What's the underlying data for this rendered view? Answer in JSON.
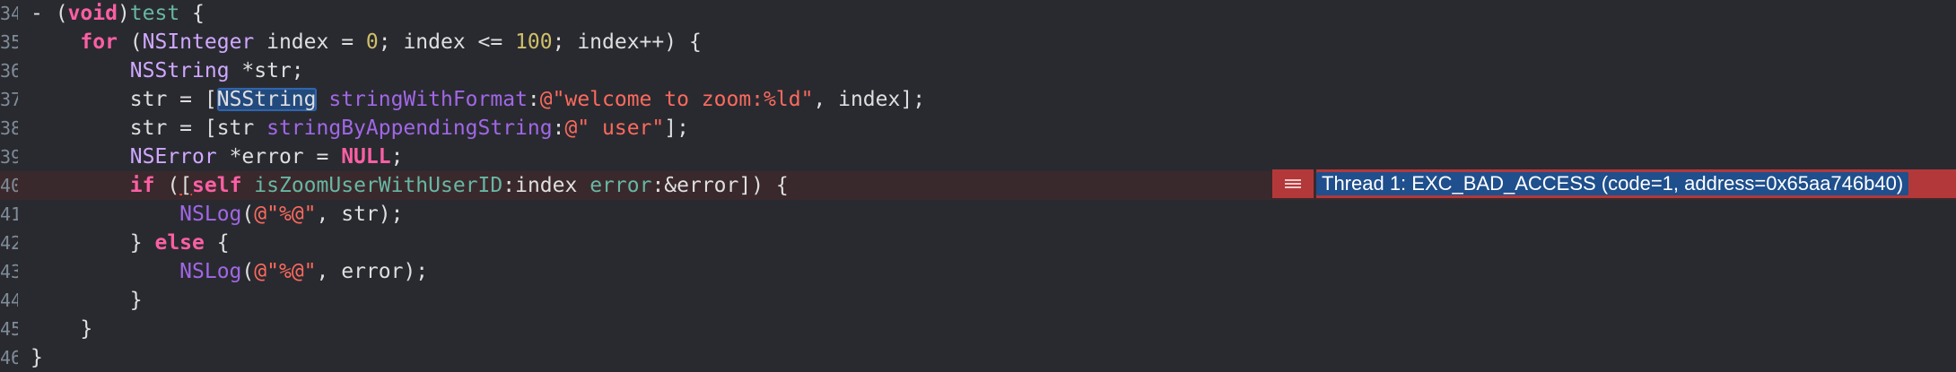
{
  "editor": {
    "lines": [
      {
        "number": "34",
        "tokens": [
          {
            "t": "- (",
            "c": "plain"
          },
          {
            "t": "void",
            "c": "kw"
          },
          {
            "t": ")",
            "c": "plain"
          },
          {
            "t": "test",
            "c": "fnb"
          },
          {
            "t": " {",
            "c": "plain"
          }
        ]
      },
      {
        "number": "35",
        "tokens": [
          {
            "t": "    ",
            "c": "plain"
          },
          {
            "t": "for",
            "c": "kw"
          },
          {
            "t": " (",
            "c": "plain"
          },
          {
            "t": "NSInteger",
            "c": "type"
          },
          {
            "t": " index = ",
            "c": "plain"
          },
          {
            "t": "0",
            "c": "num"
          },
          {
            "t": "; index <= ",
            "c": "plain"
          },
          {
            "t": "100",
            "c": "num"
          },
          {
            "t": "; index++) {",
            "c": "plain"
          }
        ]
      },
      {
        "number": "36",
        "tokens": [
          {
            "t": "        ",
            "c": "plain"
          },
          {
            "t": "NSString",
            "c": "type"
          },
          {
            "t": " *str;",
            "c": "plain"
          }
        ]
      },
      {
        "number": "37",
        "tokens": [
          {
            "t": "        str = [",
            "c": "plain"
          },
          {
            "t": "NSString",
            "c": "sel"
          },
          {
            "t": " ",
            "c": "plain"
          },
          {
            "t": "stringWithFormat",
            "c": "fn"
          },
          {
            "t": ":",
            "c": "plain"
          },
          {
            "t": "@\"welcome to zoom:%ld\"",
            "c": "str"
          },
          {
            "t": ", index];",
            "c": "plain"
          }
        ]
      },
      {
        "number": "38",
        "tokens": [
          {
            "t": "        str = [str ",
            "c": "plain"
          },
          {
            "t": "stringByAppendingString",
            "c": "fn"
          },
          {
            "t": ":",
            "c": "plain"
          },
          {
            "t": "@\" user\"",
            "c": "str"
          },
          {
            "t": "];",
            "c": "plain"
          }
        ]
      },
      {
        "number": "39",
        "tokens": [
          {
            "t": "        ",
            "c": "plain"
          },
          {
            "t": "NSError",
            "c": "type"
          },
          {
            "t": " *error = ",
            "c": "plain"
          },
          {
            "t": "NULL",
            "c": "kw"
          },
          {
            "t": ";",
            "c": "plain"
          }
        ]
      },
      {
        "number": "40",
        "error": true,
        "tokens": [
          {
            "t": "        ",
            "c": "plain"
          },
          {
            "t": "if",
            "c": "kw"
          },
          {
            "t": " (",
            "c": "plain"
          },
          {
            "t": "[",
            "c": "caret-under"
          },
          {
            "t": "self",
            "c": "kw"
          },
          {
            "t": " ",
            "c": "plain"
          },
          {
            "t": "isZoomUserWithUserID",
            "c": "fnb"
          },
          {
            "t": ":index ",
            "c": "plain"
          },
          {
            "t": "error",
            "c": "fnb"
          },
          {
            "t": ":&error]) {",
            "c": "plain"
          }
        ]
      },
      {
        "number": "41",
        "tokens": [
          {
            "t": "            ",
            "c": "plain"
          },
          {
            "t": "NSLog",
            "c": "fn"
          },
          {
            "t": "(",
            "c": "plain"
          },
          {
            "t": "@\"%@\"",
            "c": "str"
          },
          {
            "t": ", str);",
            "c": "plain"
          }
        ]
      },
      {
        "number": "42",
        "tokens": [
          {
            "t": "        } ",
            "c": "plain"
          },
          {
            "t": "else",
            "c": "kw"
          },
          {
            "t": " {",
            "c": "plain"
          }
        ]
      },
      {
        "number": "43",
        "tokens": [
          {
            "t": "            ",
            "c": "plain"
          },
          {
            "t": "NSLog",
            "c": "fn"
          },
          {
            "t": "(",
            "c": "plain"
          },
          {
            "t": "@\"%@\"",
            "c": "str"
          },
          {
            "t": ", error);",
            "c": "plain"
          }
        ]
      },
      {
        "number": "44",
        "tokens": [
          {
            "t": "        }",
            "c": "plain"
          }
        ]
      },
      {
        "number": "45",
        "tokens": [
          {
            "t": "    }",
            "c": "plain"
          }
        ]
      },
      {
        "number": "46",
        "tokens": [
          {
            "t": "}",
            "c": "plain"
          }
        ]
      }
    ]
  },
  "error_annotation": {
    "icon": "hamburger-icon",
    "message": "Thread 1: EXC_BAD_ACCESS (code=1, address=0x65aa746b40)",
    "color": "#b3383a"
  }
}
